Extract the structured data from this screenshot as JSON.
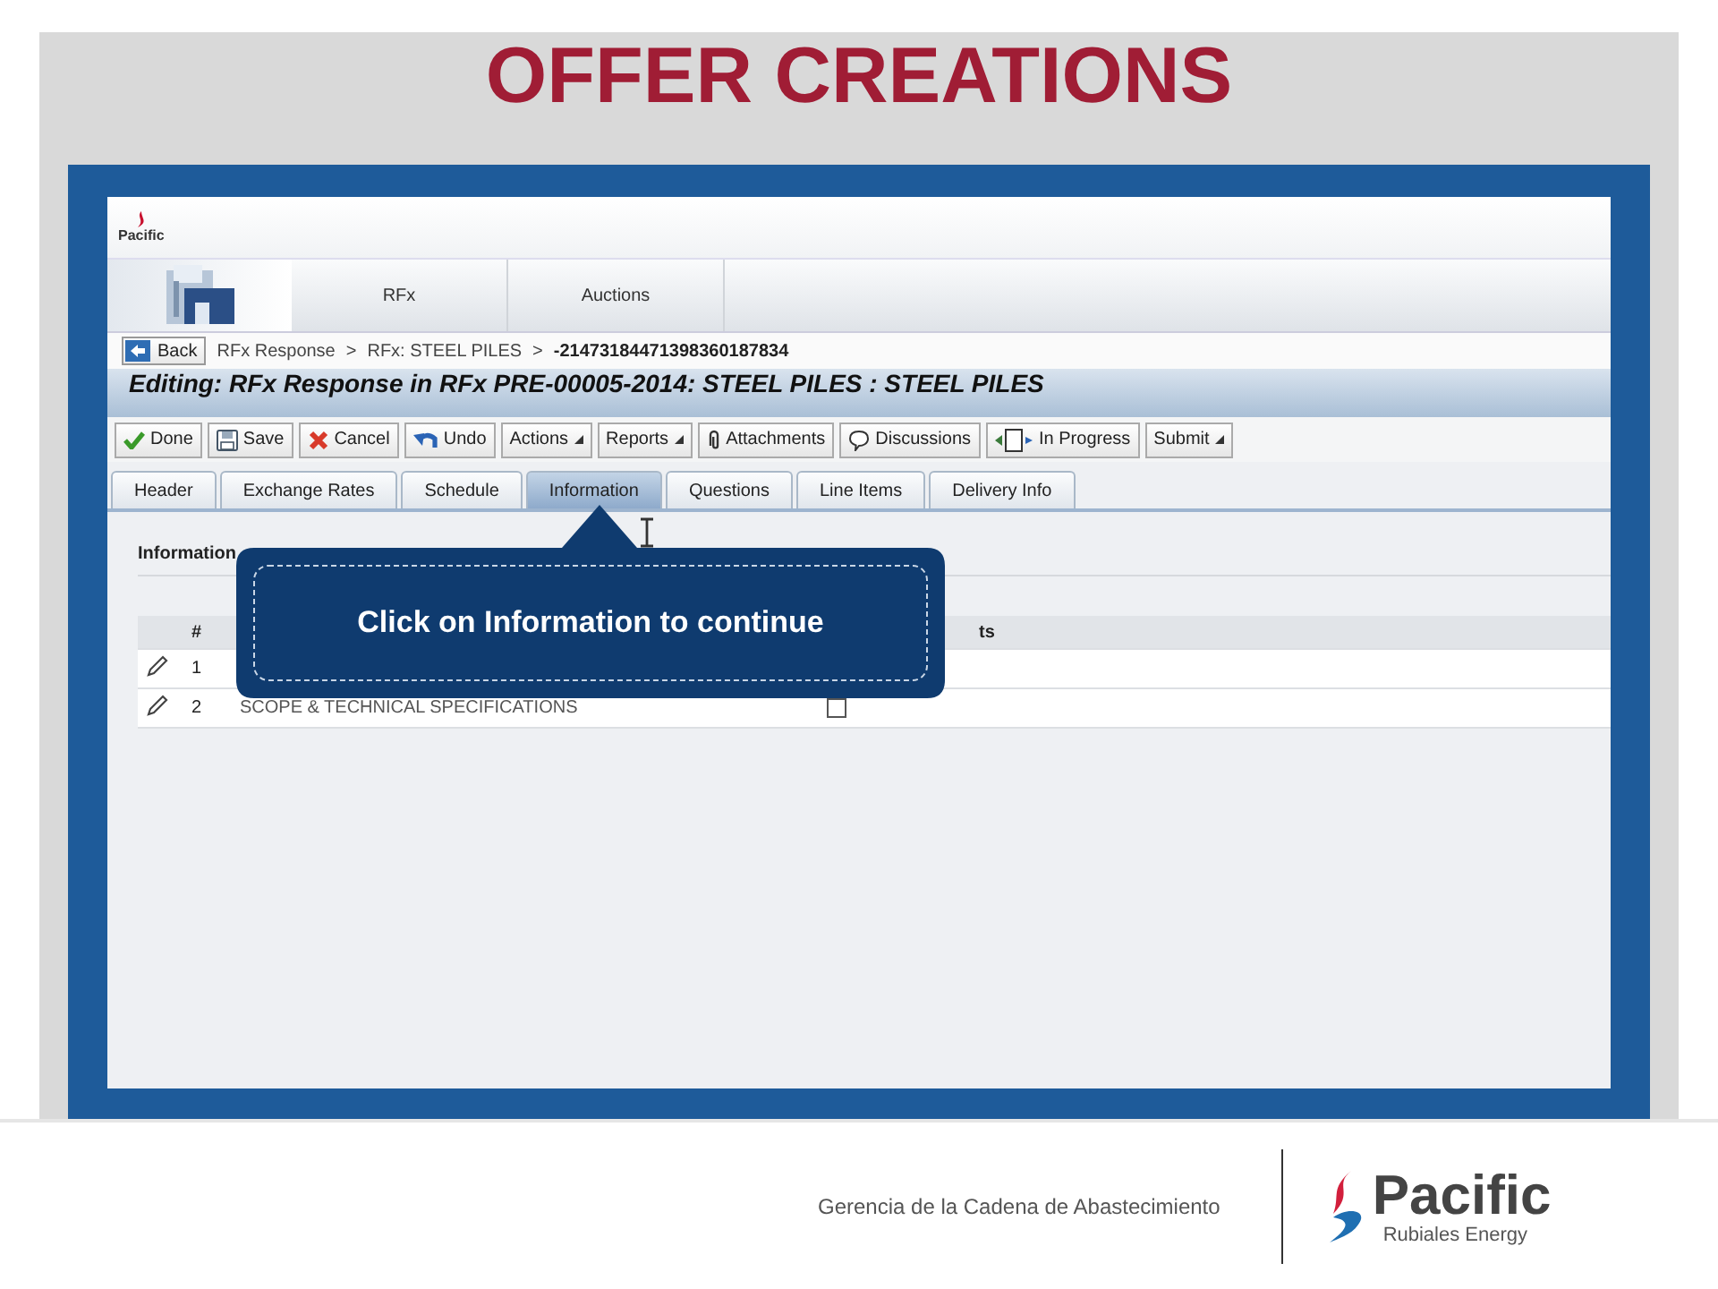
{
  "slide": {
    "title": "OFFER CREATIONS",
    "footer_text": "Gerencia de la Cadena de Abastecimiento",
    "footer_logo": {
      "name": "Pacific",
      "tagline": "Rubiales Energy"
    }
  },
  "app": {
    "logo": "Pacific",
    "nav": [
      {
        "label": "RFx"
      },
      {
        "label": "Auctions"
      }
    ],
    "back": "Back",
    "breadcrumb": [
      "RFx Response",
      "RFx: STEEL PILES",
      "-21473184471398360187834"
    ],
    "breadcrumb_separator": ">",
    "heading": "Editing: RFx Response in RFx PRE-00005-2014: STEEL PILES : STEEL PILES",
    "toolbar": [
      {
        "label": "Done",
        "kind": "done"
      },
      {
        "label": "Save",
        "kind": "save"
      },
      {
        "label": "Cancel",
        "kind": "cancel"
      },
      {
        "label": "Undo",
        "kind": "undo"
      },
      {
        "label": "Actions",
        "kind": "menu"
      },
      {
        "label": "Reports",
        "kind": "menu"
      },
      {
        "label": "Attachments",
        "kind": "attach"
      },
      {
        "label": "Discussions",
        "kind": "discuss"
      },
      {
        "label": "In Progress",
        "kind": "status"
      },
      {
        "label": "Submit",
        "kind": "menu"
      }
    ],
    "tabs": [
      {
        "label": "Header",
        "selected": false
      },
      {
        "label": "Exchange Rates",
        "selected": false
      },
      {
        "label": "Schedule",
        "selected": false
      },
      {
        "label": "Information",
        "selected": true
      },
      {
        "label": "Questions",
        "selected": false
      },
      {
        "label": "Line Items",
        "selected": false
      },
      {
        "label": "Delivery Info",
        "selected": false
      }
    ],
    "section": {
      "title": "Information",
      "columns": [
        "#",
        "ts"
      ],
      "rows": [
        {
          "number": "1"
        },
        {
          "number": "2",
          "title": "SCOPE & TECHNICAL SPECIFICATIONS",
          "checked": false
        }
      ]
    },
    "callout": "Click on Information to continue"
  }
}
